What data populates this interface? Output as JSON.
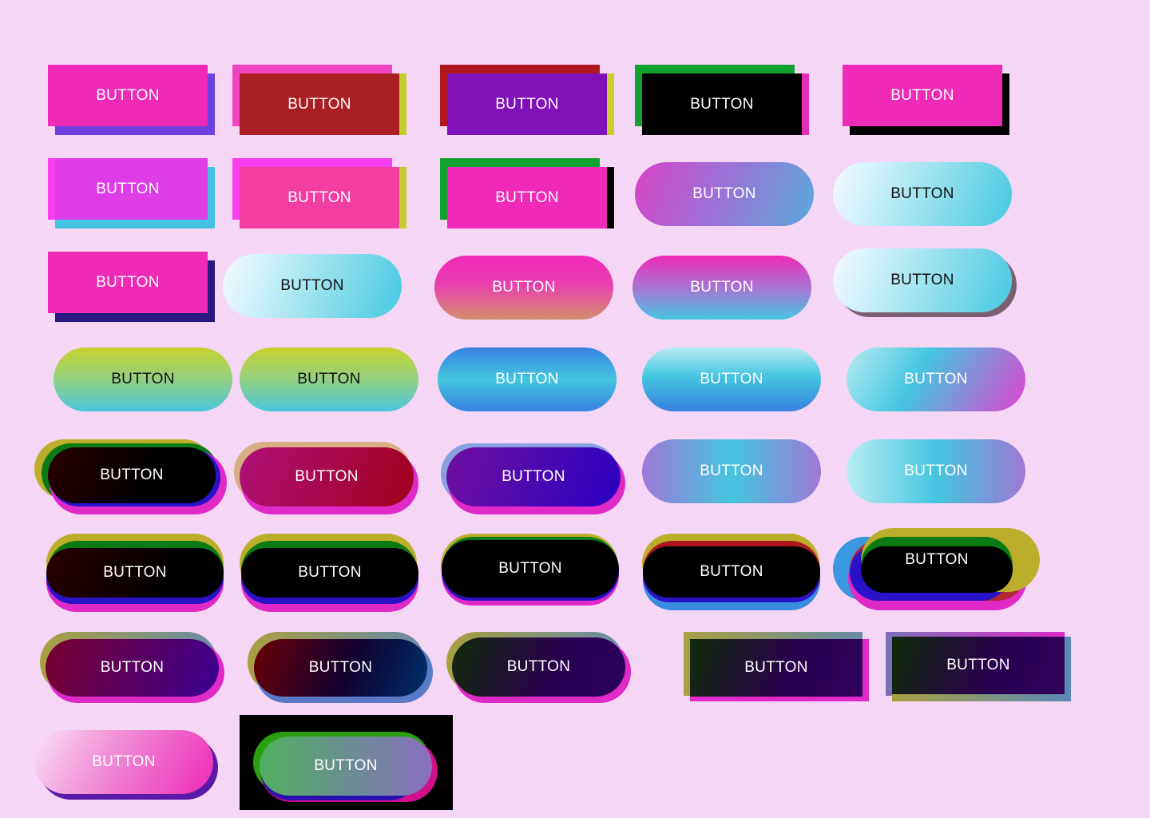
{
  "buttons": {
    "r1": [
      "BUTTON",
      "BUTTON",
      "BUTTON",
      "BUTTON",
      "BUTTON"
    ],
    "r2": [
      "BUTTON",
      "BUTTON",
      "BUTTON",
      "BUTTON",
      "BUTTON"
    ],
    "r3": [
      "BUTTON",
      "BUTTON",
      "BUTTON",
      "BUTTON",
      "BUTTON"
    ],
    "r4": [
      "BUTTON",
      "BUTTON",
      "BUTTON",
      "BUTTON",
      "BUTTON"
    ],
    "r5": [
      "BUTTON",
      "BUTTON",
      "BUTTON",
      "BUTTON",
      "BUTTON"
    ],
    "r6": [
      "BUTTON",
      "BUTTON",
      "BUTTON",
      "BUTTON",
      "BUTTON"
    ],
    "r7": [
      "BUTTON",
      "BUTTON",
      "BUTTON",
      "BUTTON",
      "BUTTON"
    ],
    "r8": [
      "BUTTON",
      "BUTTON"
    ]
  },
  "colors": {
    "background": "#f5d6f5",
    "pink": "#ee2ab6",
    "green": "#12a232",
    "cyan": "#44c6e0",
    "olive": "#c8cc2e"
  }
}
